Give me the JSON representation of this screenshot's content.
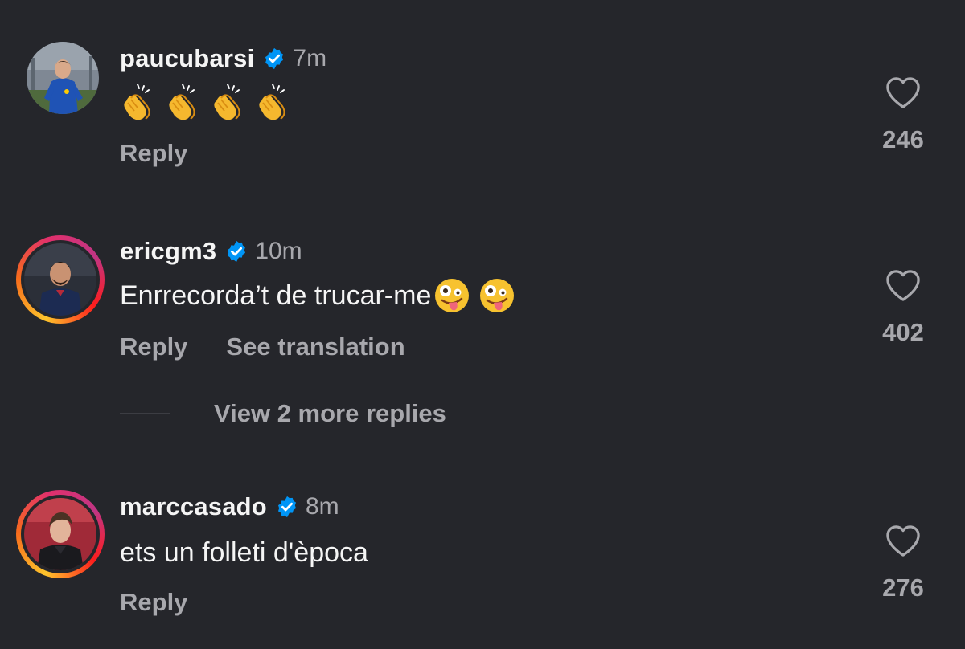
{
  "comments": [
    {
      "username": "paucubarsi",
      "time": "7m",
      "text": "",
      "emoji": [
        "clapping-hands",
        "clapping-hands",
        "clapping-hands",
        "clapping-hands"
      ],
      "reply_label": "Reply",
      "likes": "246"
    },
    {
      "username": "ericgm3",
      "time": "10m",
      "text": "Enrrecorda’t de trucar-me",
      "emoji": [
        "zany-face",
        "zany-face"
      ],
      "reply_label": "Reply",
      "translation_label": "See translation",
      "likes": "402",
      "more_replies_label": "View 2 more replies"
    },
    {
      "username": "marccasado",
      "time": "8m",
      "text": "ets un folleti d'època",
      "reply_label": "Reply",
      "likes": "276"
    }
  ],
  "colors": {
    "background": "#25262b",
    "primary_text": "#f5f5f5",
    "secondary_text": "#a8a8ad",
    "verified_blue": "#0095f6",
    "story_ring": [
      "#fdc42c",
      "#f76b1c",
      "#e1306c",
      "#c13584"
    ]
  }
}
